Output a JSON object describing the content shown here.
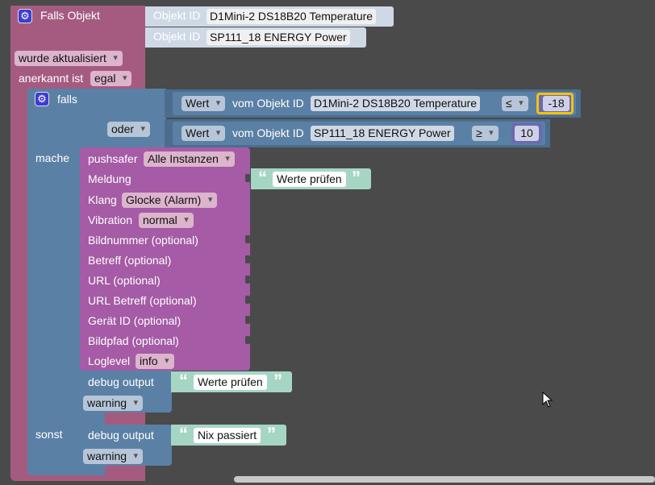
{
  "trigger": {
    "title": "Falls Objekt",
    "object_id_label": "Objekt ID",
    "object_ids": [
      "D1Mini-2 DS18B20  Temperature",
      "SP111_18 ENERGY  Power"
    ],
    "event": "wurde aktualisiert",
    "ack_label": "anerkannt ist",
    "ack_value": "egal"
  },
  "if_block": {
    "falls": "falls",
    "oder": "oder",
    "mache": "mache",
    "sonst": "sonst",
    "conditions": [
      {
        "wert": "Wert",
        "vom": "vom Objekt ID",
        "object_id": "D1Mini-2 DS18B20  Temperature",
        "op": "≤",
        "value": "-18"
      },
      {
        "wert": "Wert",
        "vom": "vom Objekt ID",
        "object_id": "SP111_18 ENERGY  Power",
        "op": "≥",
        "value": "10"
      }
    ]
  },
  "pushsafer": {
    "label": "pushsafer",
    "instance": "Alle Instanzen",
    "meldung": "Meldung",
    "message": "Werte prüfen",
    "klang": "Klang",
    "klang_value": "Glocke (Alarm)",
    "vibration": "Vibration",
    "vibration_value": "normal",
    "optional": [
      "Bildnummer (optional)",
      "Betreff (optional)",
      "URL (optional)",
      "URL Betreff (optional)",
      "Gerät ID (optional)",
      "Bildpfad (optional)"
    ],
    "loglevel": "Loglevel",
    "loglevel_value": "info"
  },
  "debug_then": {
    "label": "debug output",
    "text": "Werte prüfen",
    "level": "warning"
  },
  "debug_else": {
    "label": "debug output",
    "text": "Nix passiert",
    "level": "warning"
  },
  "icons": {
    "gear": "gear-icon",
    "quote": "quote-icon",
    "cursor": "mouse-cursor-icon"
  },
  "colors": {
    "trigger": "#a55b80",
    "logic": "#5b80a5",
    "push": "#a55ba5",
    "string": "#a5d6c4",
    "highlight": "#f5c400"
  }
}
